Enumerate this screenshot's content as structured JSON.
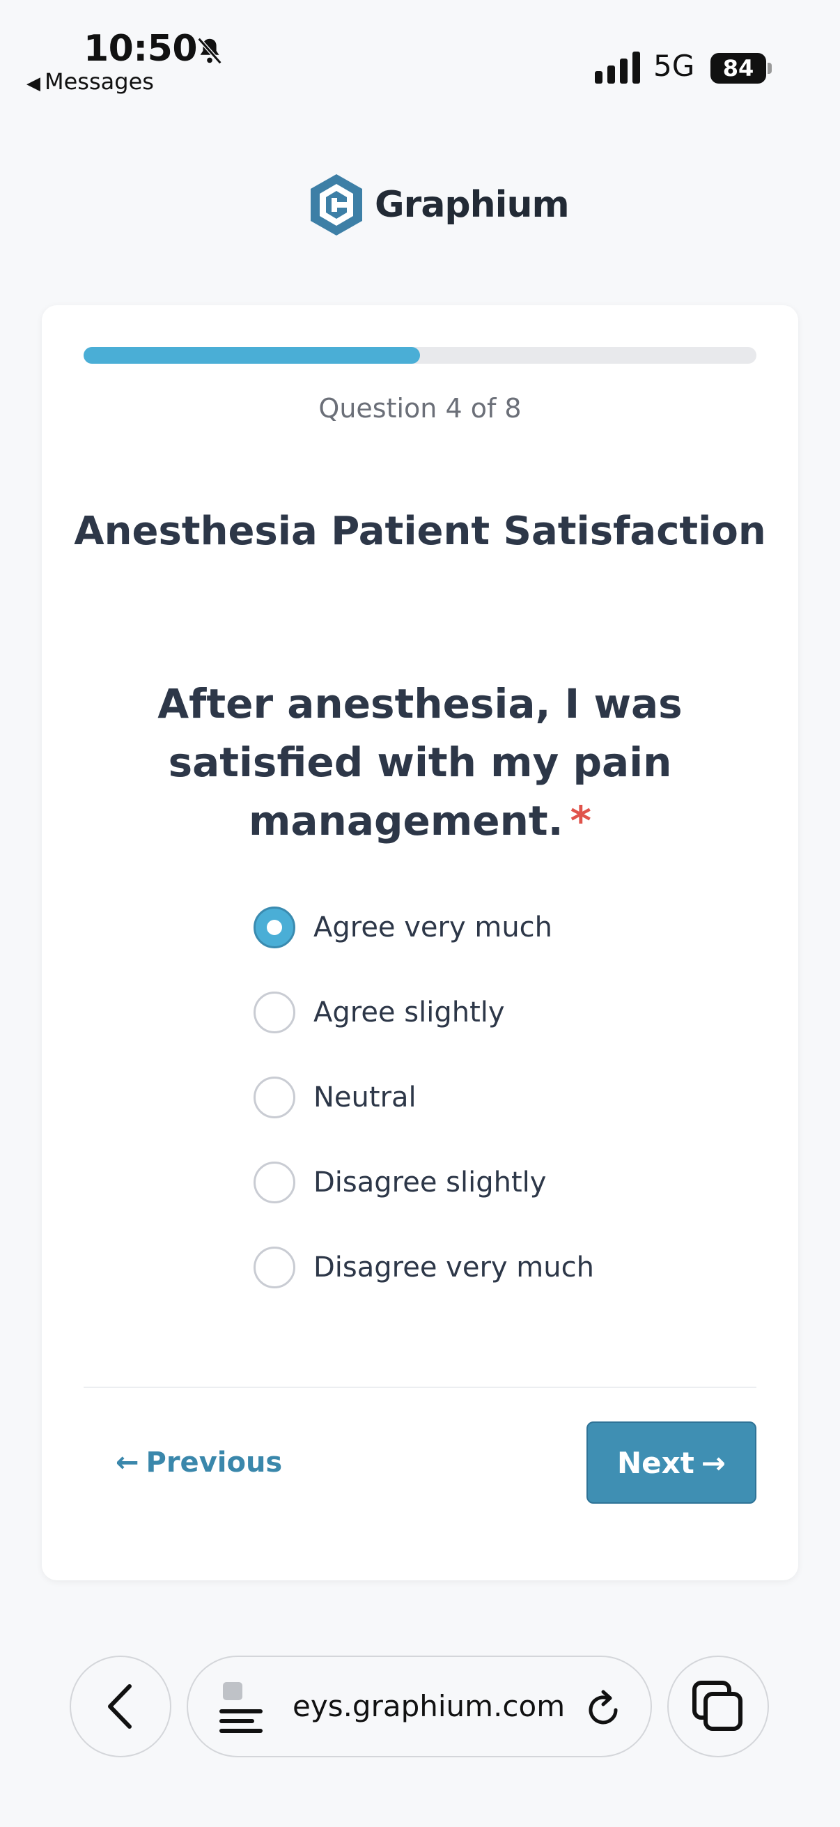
{
  "status_bar": {
    "time": "10:50",
    "back_app": "Messages",
    "network": "5G",
    "battery": "84",
    "icons": [
      "bell-slash-icon",
      "signal-icon",
      "battery-icon"
    ]
  },
  "brand": {
    "name": "Graphium",
    "logo_color": "#3d7fa6"
  },
  "survey": {
    "progress": 0.5,
    "question_count": "Question 4 of 8",
    "title": "Anesthesia Patient Satisfaction",
    "question": "After anesthesia, I was satisfied with my pain management.",
    "required_mark": "*",
    "options": [
      {
        "label": "Agree very much",
        "selected": true
      },
      {
        "label": "Agree slightly",
        "selected": false
      },
      {
        "label": "Neutral",
        "selected": false
      },
      {
        "label": "Disagree slightly",
        "selected": false
      },
      {
        "label": "Disagree very much",
        "selected": false
      }
    ],
    "prev_label": "Previous",
    "next_label": "Next",
    "prev_arrow": "←",
    "next_arrow": "→"
  },
  "browser": {
    "url": "eys.graphium.com",
    "icons": [
      "back-chevron-icon",
      "page-menu-icon",
      "reload-icon",
      "tabs-icon"
    ]
  },
  "colors": {
    "accent": "#4aaed6",
    "button": "#3f8fb3",
    "required": "#e0534b"
  }
}
